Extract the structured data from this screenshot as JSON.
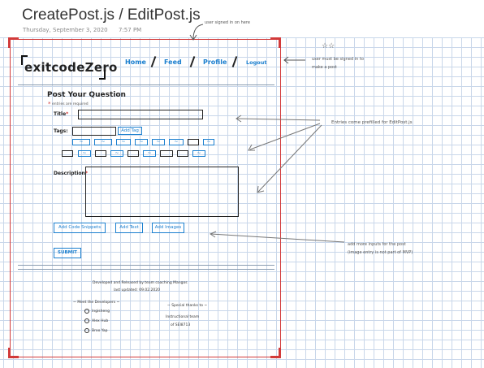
{
  "doc": {
    "title": "CreatePost.js / EditPost.js",
    "date": "Thursday, September 3, 2020",
    "time": "7:57 PM"
  },
  "app": {
    "logo": "exitcodeZero",
    "nav": [
      "Home",
      "Feed",
      "Profile",
      "Logout"
    ]
  },
  "form": {
    "heading": "Post Your Question",
    "required_note": "entries are required",
    "title_label": "Title",
    "tags_label": "Tags",
    "add_tag": "Add Tag",
    "description_label": "Description",
    "tag_mark": "~",
    "buttons": [
      "Add Code Snippets",
      "Add Text",
      "Add Images"
    ],
    "submit": "SUBMIT"
  },
  "notes": {
    "top": "user signed in on here",
    "stars": "☆☆",
    "signed_line1": "user must be signed in to",
    "signed_line2": "make a post",
    "prefilled": "Entries come prefilled for EditPost.js",
    "inputs_line1": "add more inputs for the post",
    "inputs_line2": "(image entry is not part of MVP)"
  },
  "footer": {
    "line1": "Developed and Released by team coaching Mangos",
    "line2": "last updated: 09.02.2020",
    "meet_heading": "~ Meet the Developers ~",
    "developers": [
      "Ingisheng",
      "Alex Hub",
      "Broo Yap"
    ],
    "thanks_heading": "~ Special thanks to ~",
    "thanks_line1": "Instructional team",
    "thanks_line2": "of SEI8713"
  }
}
